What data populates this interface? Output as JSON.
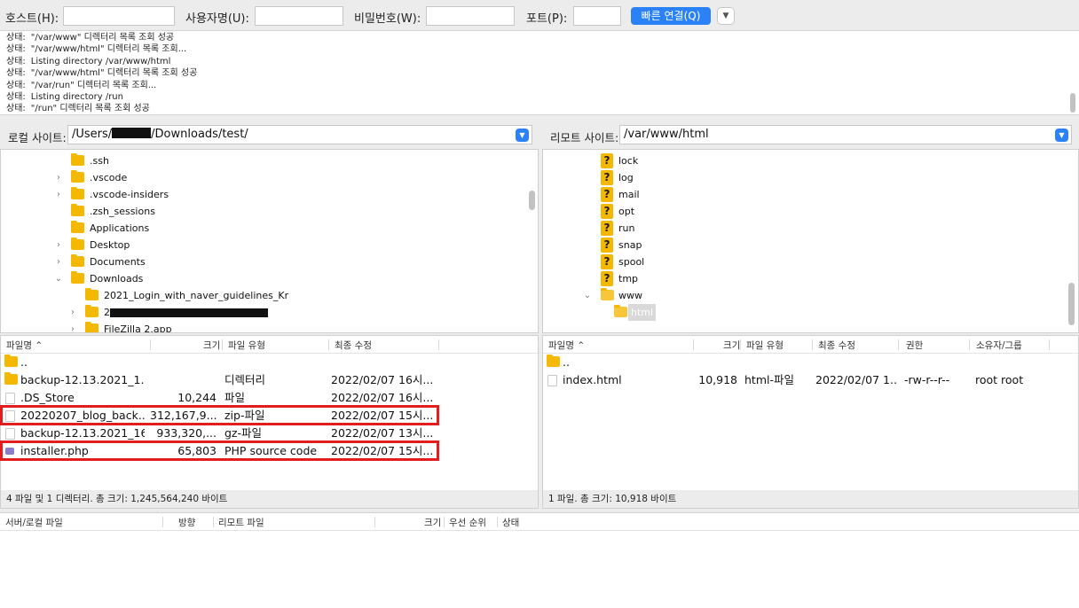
{
  "quickconnect": {
    "host_label": "호스트(H):",
    "host_value": "",
    "user_label": "사용자명(U):",
    "user_value": "",
    "pass_label": "비밀번호(W):",
    "pass_value": "",
    "port_label": "포트(P):",
    "port_value": "",
    "connect_label": "빠른 연결(Q)",
    "dropdown_icon": "chevron-down-icon"
  },
  "log": [
    {
      "label": "상태:",
      "text": "\"/var/www\" 디렉터리 목록 조회 성공"
    },
    {
      "label": "상태:",
      "text": "\"/var/www/html\" 디렉터리 목록 조회..."
    },
    {
      "label": "상태:",
      "text": "Listing directory /var/www/html"
    },
    {
      "label": "상태:",
      "text": "\"/var/www/html\" 디렉터리 목록 조회 성공"
    },
    {
      "label": "상태:",
      "text": "\"/var/run\" 디렉터리 목록 조회..."
    },
    {
      "label": "상태:",
      "text": "Listing directory /run"
    },
    {
      "label": "상태:",
      "text": "\"/run\" 디렉터리 목록 조회 성공"
    }
  ],
  "local": {
    "site_label": "로컬 사이트:",
    "path_prefix": "/Users/",
    "path_suffix": "/Downloads/test/",
    "tree": [
      {
        "name": ".ssh",
        "chevron": ""
      },
      {
        "name": ".vscode",
        "chevron": "›"
      },
      {
        "name": ".vscode-insiders",
        "chevron": "›"
      },
      {
        "name": ".zsh_sessions",
        "chevron": ""
      },
      {
        "name": "Applications",
        "chevron": ""
      },
      {
        "name": "Desktop",
        "chevron": "›"
      },
      {
        "name": "Documents",
        "chevron": "›"
      },
      {
        "name": "Downloads",
        "chevron": "⌄"
      },
      {
        "name": "2021_Login_with_naver_guidelines_Kr",
        "chevron": ""
      },
      {
        "name": "2",
        "chevron": "›"
      },
      {
        "name": "FileZilla 2.app",
        "chevron": "›"
      }
    ],
    "headers": {
      "name": "파일명",
      "size": "크기",
      "type": "파일 유형",
      "modified": "최종 수정"
    },
    "files": [
      {
        "name": "..",
        "size": "",
        "type": "",
        "modified": "",
        "icon": "folder-icon"
      },
      {
        "name": "backup-12.13.2021_1...",
        "size": "",
        "type": "디렉터리",
        "modified": "2022/02/07 16시...",
        "icon": "folder-icon"
      },
      {
        "name": ".DS_Store",
        "size": "10,244",
        "type": "파일",
        "modified": "2022/02/07 16시...",
        "icon": "file-icon"
      },
      {
        "name": "20220207_blog_back...",
        "size": "312,167,9...",
        "type": "zip-파일",
        "modified": "2022/02/07 15시...",
        "icon": "file-icon"
      },
      {
        "name": "backup-12.13.2021_16...",
        "size": "933,320,...",
        "type": "gz-파일",
        "modified": "2022/02/07 13시...",
        "icon": "file-icon"
      },
      {
        "name": "installer.php",
        "size": "65,803",
        "type": "PHP source code",
        "modified": "2022/02/07 15시...",
        "icon": "php-file-icon"
      }
    ],
    "status": "4 파일 및 1 디렉터리. 총 크기: 1,245,564,240 바이트"
  },
  "remote": {
    "site_label": "리모트 사이트:",
    "path": "/var/www/html",
    "tree": [
      {
        "name": "lock",
        "type": "unknown"
      },
      {
        "name": "log",
        "type": "unknown"
      },
      {
        "name": "mail",
        "type": "unknown"
      },
      {
        "name": "opt",
        "type": "unknown"
      },
      {
        "name": "run",
        "type": "unknown"
      },
      {
        "name": "snap",
        "type": "unknown"
      },
      {
        "name": "spool",
        "type": "unknown"
      },
      {
        "name": "tmp",
        "type": "unknown"
      },
      {
        "name": "www",
        "type": "folder"
      },
      {
        "name": "html",
        "type": "folder-selected"
      }
    ],
    "headers": {
      "name": "파일명",
      "size": "크기",
      "type": "파일 유형",
      "modified": "최종 수정",
      "perm": "권한",
      "owner": "소유자/그룹"
    },
    "files": [
      {
        "name": "..",
        "size": "",
        "type": "",
        "modified": "",
        "perm": "",
        "owner": "",
        "icon": "folder-icon"
      },
      {
        "name": "index.html",
        "size": "10,918",
        "type": "html-파일",
        "modified": "2022/02/07 1...",
        "perm": "-rw-r--r--",
        "owner": "root root",
        "icon": "file-icon"
      }
    ],
    "status": "1 파일. 총 크기: 10,918 바이트"
  },
  "queue": {
    "headers": {
      "server_file": "서버/로컬 파일",
      "direction": "방향",
      "remote_file": "리모트 파일",
      "size": "크기",
      "priority": "우선 순위",
      "status": "상태"
    }
  },
  "colors": {
    "accent": "#2b82f6",
    "highlight": "#e11d1d",
    "folder": "#f5b800"
  }
}
